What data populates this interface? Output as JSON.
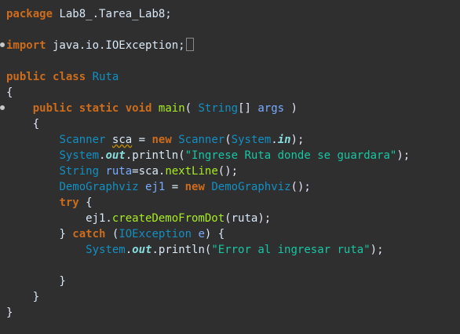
{
  "editor": {
    "lines": [
      {
        "t": [
          [
            "kw",
            "package"
          ],
          [
            "plain",
            " Lab8_.Tarea_Lab8;"
          ]
        ]
      },
      {
        "t": []
      },
      {
        "t": [
          [
            "kw",
            "import"
          ],
          [
            "plain",
            " java.io.IOException;"
          ]
        ]
      },
      {
        "t": []
      },
      {
        "t": [
          [
            "kw",
            "public"
          ],
          [
            "plain",
            " "
          ],
          [
            "kw",
            "class"
          ],
          [
            "plain",
            " "
          ],
          [
            "type",
            "Ruta"
          ]
        ]
      },
      {
        "t": [
          [
            "punc",
            "{"
          ]
        ]
      },
      {
        "t": [
          [
            "plain",
            "    "
          ],
          [
            "kw",
            "public"
          ],
          [
            "plain",
            " "
          ],
          [
            "kw",
            "static"
          ],
          [
            "plain",
            " "
          ],
          [
            "kw",
            "void"
          ],
          [
            "plain",
            " "
          ],
          [
            "method",
            "main"
          ],
          [
            "punc",
            "( "
          ],
          [
            "type",
            "String"
          ],
          [
            "punc",
            "[] "
          ],
          [
            "param",
            "args"
          ],
          [
            "punc",
            " )"
          ]
        ]
      },
      {
        "t": [
          [
            "plain",
            "    "
          ],
          [
            "punc",
            "{"
          ]
        ]
      },
      {
        "t": [
          [
            "plain",
            "        "
          ],
          [
            "type",
            "Scanner"
          ],
          [
            "plain",
            " "
          ],
          [
            "warn",
            "sca"
          ],
          [
            "plain",
            " = "
          ],
          [
            "kw",
            "new"
          ],
          [
            "plain",
            " "
          ],
          [
            "type",
            "Scanner"
          ],
          [
            "punc",
            "("
          ],
          [
            "type",
            "System"
          ],
          [
            "punc",
            "."
          ],
          [
            "field",
            "in"
          ],
          [
            "punc",
            ");"
          ]
        ]
      },
      {
        "t": [
          [
            "plain",
            "        "
          ],
          [
            "type",
            "System"
          ],
          [
            "punc",
            "."
          ],
          [
            "field",
            "out"
          ],
          [
            "punc",
            "."
          ],
          [
            "plain",
            "println("
          ],
          [
            "str",
            "\"Ingrese Ruta donde se guardara\""
          ],
          [
            "punc",
            ");"
          ]
        ]
      },
      {
        "t": [
          [
            "plain",
            "        "
          ],
          [
            "type",
            "String"
          ],
          [
            "plain",
            " "
          ],
          [
            "param",
            "ruta"
          ],
          [
            "plain",
            "=sca."
          ],
          [
            "method",
            "nextLine"
          ],
          [
            "punc",
            "();"
          ]
        ]
      },
      {
        "t": [
          [
            "plain",
            "        "
          ],
          [
            "type",
            "DemoGraphviz"
          ],
          [
            "plain",
            " "
          ],
          [
            "param",
            "ej1"
          ],
          [
            "plain",
            " = "
          ],
          [
            "kw",
            "new"
          ],
          [
            "plain",
            " "
          ],
          [
            "type",
            "DemoGraphviz"
          ],
          [
            "punc",
            "();"
          ]
        ]
      },
      {
        "t": [
          [
            "plain",
            "        "
          ],
          [
            "kw",
            "try"
          ],
          [
            "plain",
            " {"
          ]
        ]
      },
      {
        "t": [
          [
            "plain",
            "            ej1."
          ],
          [
            "method",
            "createDemoFromDot"
          ],
          [
            "punc",
            "("
          ],
          [
            "plain",
            "ruta"
          ],
          [
            "punc",
            ");"
          ]
        ]
      },
      {
        "t": [
          [
            "plain",
            "        } "
          ],
          [
            "kw",
            "catch"
          ],
          [
            "plain",
            " ("
          ],
          [
            "type",
            "IOException"
          ],
          [
            "plain",
            " "
          ],
          [
            "param",
            "e"
          ],
          [
            "plain",
            ") {"
          ]
        ]
      },
      {
        "t": [
          [
            "plain",
            "            "
          ],
          [
            "type",
            "System"
          ],
          [
            "punc",
            "."
          ],
          [
            "field",
            "out"
          ],
          [
            "punc",
            "."
          ],
          [
            "plain",
            "println("
          ],
          [
            "str",
            "\"Error al ingresar ruta\""
          ],
          [
            "punc",
            ");"
          ]
        ]
      },
      {
        "t": []
      },
      {
        "t": [
          [
            "plain",
            "        }"
          ]
        ]
      },
      {
        "t": [
          [
            "plain",
            "    }"
          ]
        ]
      },
      {
        "t": [
          [
            "punc",
            "}"
          ]
        ]
      }
    ]
  },
  "colors": {
    "background": "#2f2f2f",
    "keyword": "#cc6c1d",
    "type": "#1290c3",
    "method": "#a7ec21",
    "string": "#17c6a3"
  }
}
